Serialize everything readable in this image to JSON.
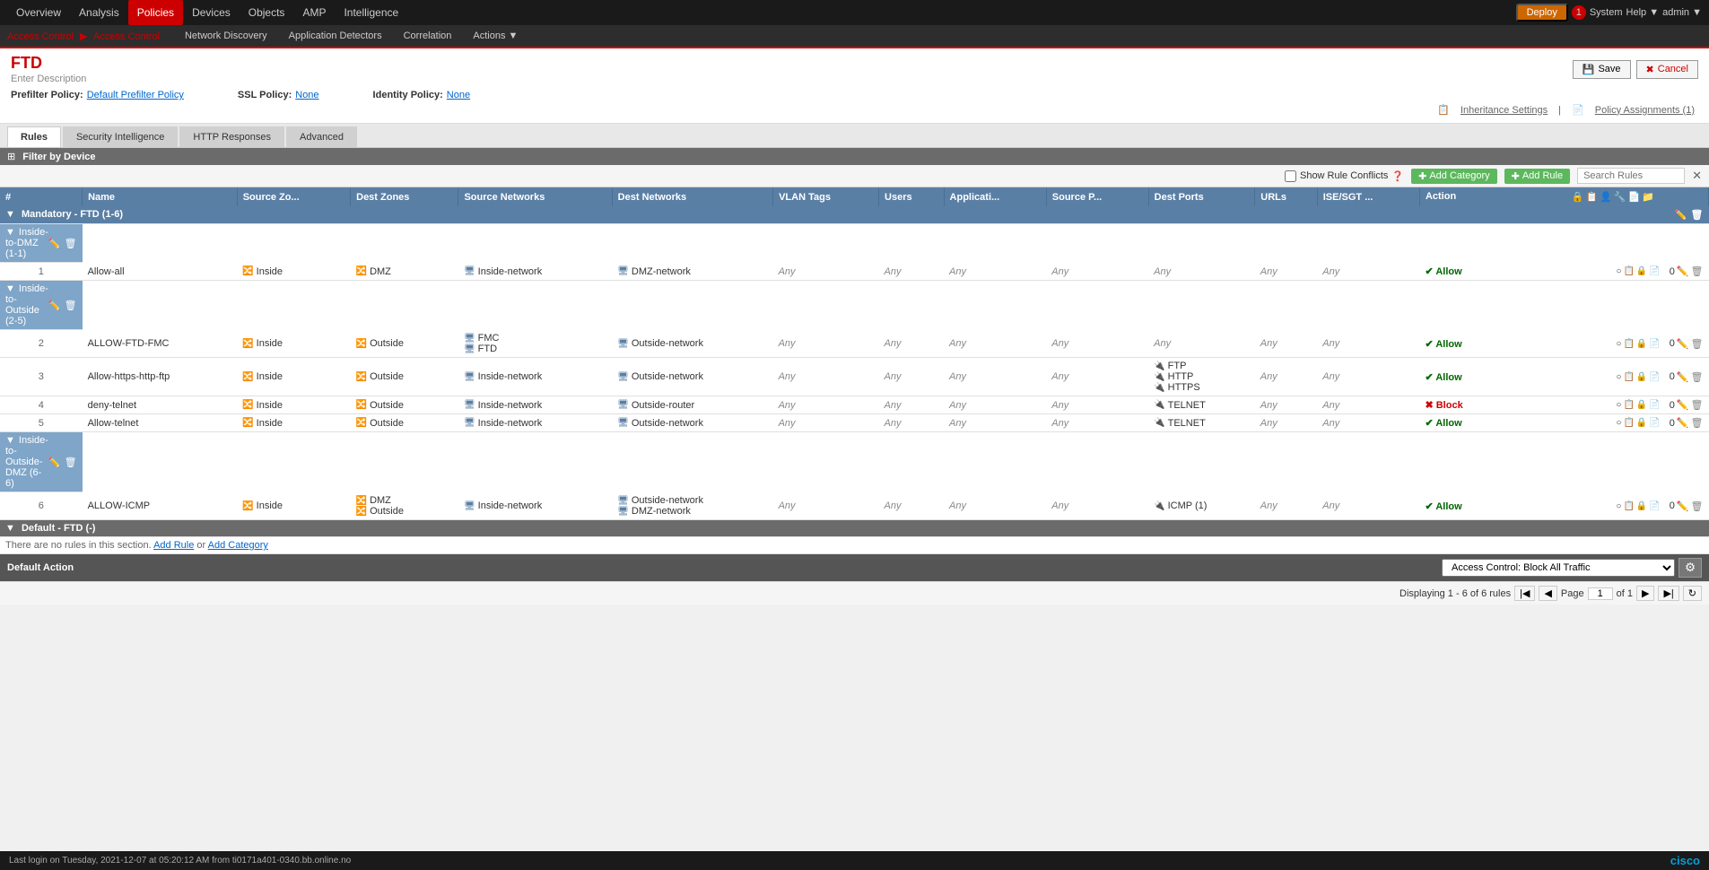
{
  "topnav": {
    "items": [
      "Overview",
      "Analysis",
      "Policies",
      "Devices",
      "Objects",
      "AMP",
      "Intelligence"
    ],
    "active": "Policies",
    "deploy": "Deploy",
    "system": "System",
    "help": "Help ▼",
    "admin": "admin ▼"
  },
  "secondnav": {
    "breadcrumb_left": "Access Control",
    "breadcrumb_right": "Access Control",
    "tabs": [
      "Network Discovery",
      "Application Detectors",
      "Correlation",
      "Actions ▼"
    ]
  },
  "page": {
    "title": "FTD",
    "description": "Enter Description",
    "save_label": "Save",
    "cancel_label": "Cancel",
    "prefilter_label": "Prefilter Policy:",
    "prefilter_value": "Default Prefilter Policy",
    "ssl_label": "SSL Policy:",
    "ssl_value": "None",
    "identity_label": "Identity Policy:",
    "identity_value": "None",
    "inheritance_label": "Inheritance Settings",
    "policy_assignments": "Policy Assignments (1)"
  },
  "tabs": {
    "items": [
      "Rules",
      "Security Intelligence",
      "HTTP Responses",
      "Advanced"
    ],
    "active": 0
  },
  "filter": {
    "label": "Filter by Device"
  },
  "toolbar": {
    "show_conflicts": "Show Rule Conflicts",
    "add_category": "Add Category",
    "add_rule": "Add Rule",
    "search_placeholder": "Search Rules"
  },
  "table": {
    "columns": [
      "#",
      "Name",
      "Source Zo...",
      "Dest Zones",
      "Source Networks",
      "Dest Networks",
      "VLAN Tags",
      "Users",
      "Applicati...",
      "Source P...",
      "Dest Ports",
      "URLs",
      "ISE/SGT ...",
      "Action"
    ],
    "sections": [
      {
        "type": "mandatory",
        "label": "Mandatory - FTD (1-6)",
        "categories": [
          {
            "label": "Inside-to-DMZ (1-1)",
            "rows": [
              {
                "num": "1",
                "name": "Allow-all",
                "src_zone": "Inside",
                "dest_zone": "DMZ",
                "src_network": "Inside-network",
                "dest_network": "DMZ-network",
                "vlan": "Any",
                "users": "Any",
                "apps": "Any",
                "src_port": "Any",
                "dest_port": "Any",
                "urls": "Any",
                "ise": "Any",
                "action": "Allow",
                "action_type": "allow",
                "count": "0"
              }
            ]
          },
          {
            "label": "Inside-to-Outside (2-5)",
            "rows": [
              {
                "num": "2",
                "name": "ALLOW-FTD-FMC",
                "src_zone": "Inside",
                "dest_zone": "Outside",
                "src_network": "FMC\nFTD",
                "dest_network": "Outside-network",
                "vlan": "Any",
                "users": "Any",
                "apps": "Any",
                "src_port": "Any",
                "dest_port": "Any",
                "urls": "Any",
                "ise": "Any",
                "action": "Allow",
                "action_type": "allow",
                "count": "0"
              },
              {
                "num": "3",
                "name": "Allow-https-http-ftp",
                "src_zone": "Inside",
                "dest_zone": "Outside",
                "src_network": "Inside-network",
                "dest_network": "Outside-network",
                "vlan": "Any",
                "users": "Any",
                "apps": "Any",
                "src_port": "Any",
                "dest_port": "FTP\nHTTP\nHTTPS",
                "urls": "Any",
                "ise": "Any",
                "action": "Allow",
                "action_type": "allow",
                "count": "0"
              },
              {
                "num": "4",
                "name": "deny-telnet",
                "src_zone": "Inside",
                "dest_zone": "Outside",
                "src_network": "Inside-network",
                "dest_network": "Outside-router",
                "vlan": "Any",
                "users": "Any",
                "apps": "Any",
                "src_port": "Any",
                "dest_port": "TELNET",
                "urls": "Any",
                "ise": "Any",
                "action": "Block",
                "action_type": "block",
                "count": "0"
              },
              {
                "num": "5",
                "name": "Allow-telnet",
                "src_zone": "Inside",
                "dest_zone": "Outside",
                "src_network": "Inside-network",
                "dest_network": "Outside-network",
                "vlan": "Any",
                "users": "Any",
                "apps": "Any",
                "src_port": "Any",
                "dest_port": "TELNET",
                "urls": "Any",
                "ise": "Any",
                "action": "Allow",
                "action_type": "allow",
                "count": "0"
              }
            ]
          },
          {
            "label": "Inside-to-Outside-DMZ (6-6)",
            "rows": [
              {
                "num": "6",
                "name": "ALLOW-ICMP",
                "src_zone": "Inside",
                "dest_zone": "DMZ\nOutside",
                "src_network": "Inside-network",
                "dest_network": "Outside-network\nDMZ-network",
                "vlan": "Any",
                "users": "Any",
                "apps": "Any",
                "src_port": "Any",
                "dest_port": "ICMP (1)",
                "urls": "Any",
                "ise": "Any",
                "action": "Allow",
                "action_type": "allow",
                "count": "0"
              }
            ]
          }
        ]
      },
      {
        "type": "default",
        "label": "Default - FTD (-)",
        "empty_text": "There are no rules in this section.",
        "add_rule_link": "Add Rule",
        "add_cat_link": "Add Category"
      }
    ]
  },
  "default_action": {
    "label": "Default Action",
    "value": "Access Control: Block All Traffic"
  },
  "pagination": {
    "displaying": "Displaying 1 - 6 of 6 rules",
    "page_label": "Page",
    "page_num": "1",
    "of_label": "of 1"
  },
  "statusbar": {
    "last_login": "Last login on Tuesday, 2021-12-07 at 05:20:12 AM from ti0171a401-0340.bb.online.no",
    "cisco_logo": "cisco"
  },
  "alert_count": "1"
}
